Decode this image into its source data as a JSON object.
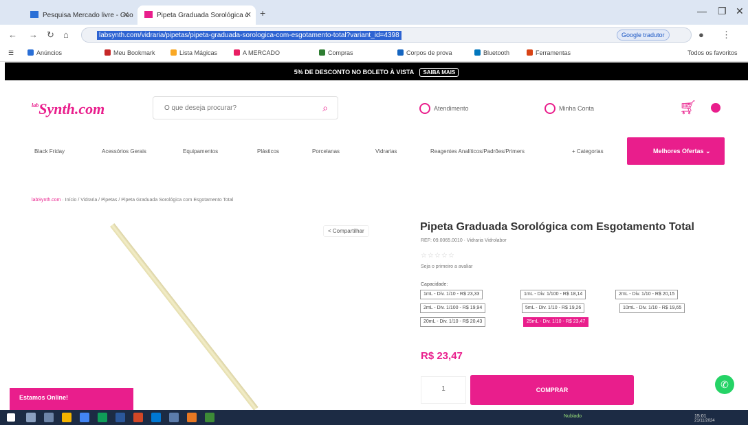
{
  "browser": {
    "tabs": [
      {
        "label": "Pesquisa Mercado livre - Google"
      },
      {
        "label": "Pipeta Graduada Sorológica c"
      }
    ],
    "url": "labsynth.com/vidraria/pipetas/pipeta-graduada-sorologica-com-esgotamento-total?variant_id=4398",
    "translate_label": "Google tradutor",
    "bookmarks": [
      "Anúncios",
      "Meu Bookmark",
      "Lista Mágicas",
      "A MERCADO",
      "Compras",
      "Corpos de prova",
      "Bluetooth",
      "Ferramentas"
    ],
    "bookmarks_right": "Todos os favoritos"
  },
  "promo": {
    "text": "5% DE DESCONTO NO BOLETO À VISTA",
    "link": "SAIBA MAIS"
  },
  "header": {
    "logo_small": "lab",
    "logo_main": "Synth.com",
    "search_placeholder": "O que deseja procurar?",
    "atendimento": "Atendimento",
    "conta": "Minha Conta"
  },
  "menu": {
    "items": [
      "Black Friday",
      "Acessórios Gerais",
      "Equipamentos",
      "Plásticos",
      "Porcelanas",
      "Vidrarias",
      "Reagentes Analíticos/Padrões/Primers",
      "+ Categorias"
    ],
    "ofertas": "Melhores Ofertas"
  },
  "breadcrumb": [
    "labSynth.com",
    "Início",
    "Vidraria",
    "Pipetas",
    "Pipeta Graduada Sorológica com Esgotamento Total"
  ],
  "product": {
    "share": "Compartilhar",
    "title": "Pipeta Graduada Sorológica com Esgotamento Total",
    "sku": "REF: 09.0065.0010 · Vidraria Vidrolabor",
    "stars": "☆☆☆☆☆",
    "reviews": "Seja o primeiro a avaliar",
    "capacity_label": "Capacidade:",
    "options": [
      "1mL - Div. 1/10 - R$ 23,33",
      "1mL - Div. 1/100 - R$ 18,14",
      "2mL - Div. 1/10 - R$ 20,15",
      "2mL - Div. 1/100 - R$ 19,94",
      "5mL - Div. 1/10 - R$ 19,26",
      "10mL - Div. 1/10 - R$ 19,65",
      "20mL - Div. 1/10 - R$ 20,43",
      "25mL - Div. 1/10 - R$ 23,47"
    ],
    "selected_option": "25mL - Div. 1/10 - R$ 23,47",
    "price": "R$ 23,47",
    "qty": "1",
    "buy": "COMPRAR"
  },
  "chat": {
    "label": "Estamos Online!"
  },
  "taskbar": {
    "weather": "Nublado",
    "time": "15:01",
    "date": "21/11/2024"
  },
  "colors": {
    "brand": "#e91e8c",
    "promo_bg": "#000000",
    "taskbar": "#1c2b44"
  }
}
